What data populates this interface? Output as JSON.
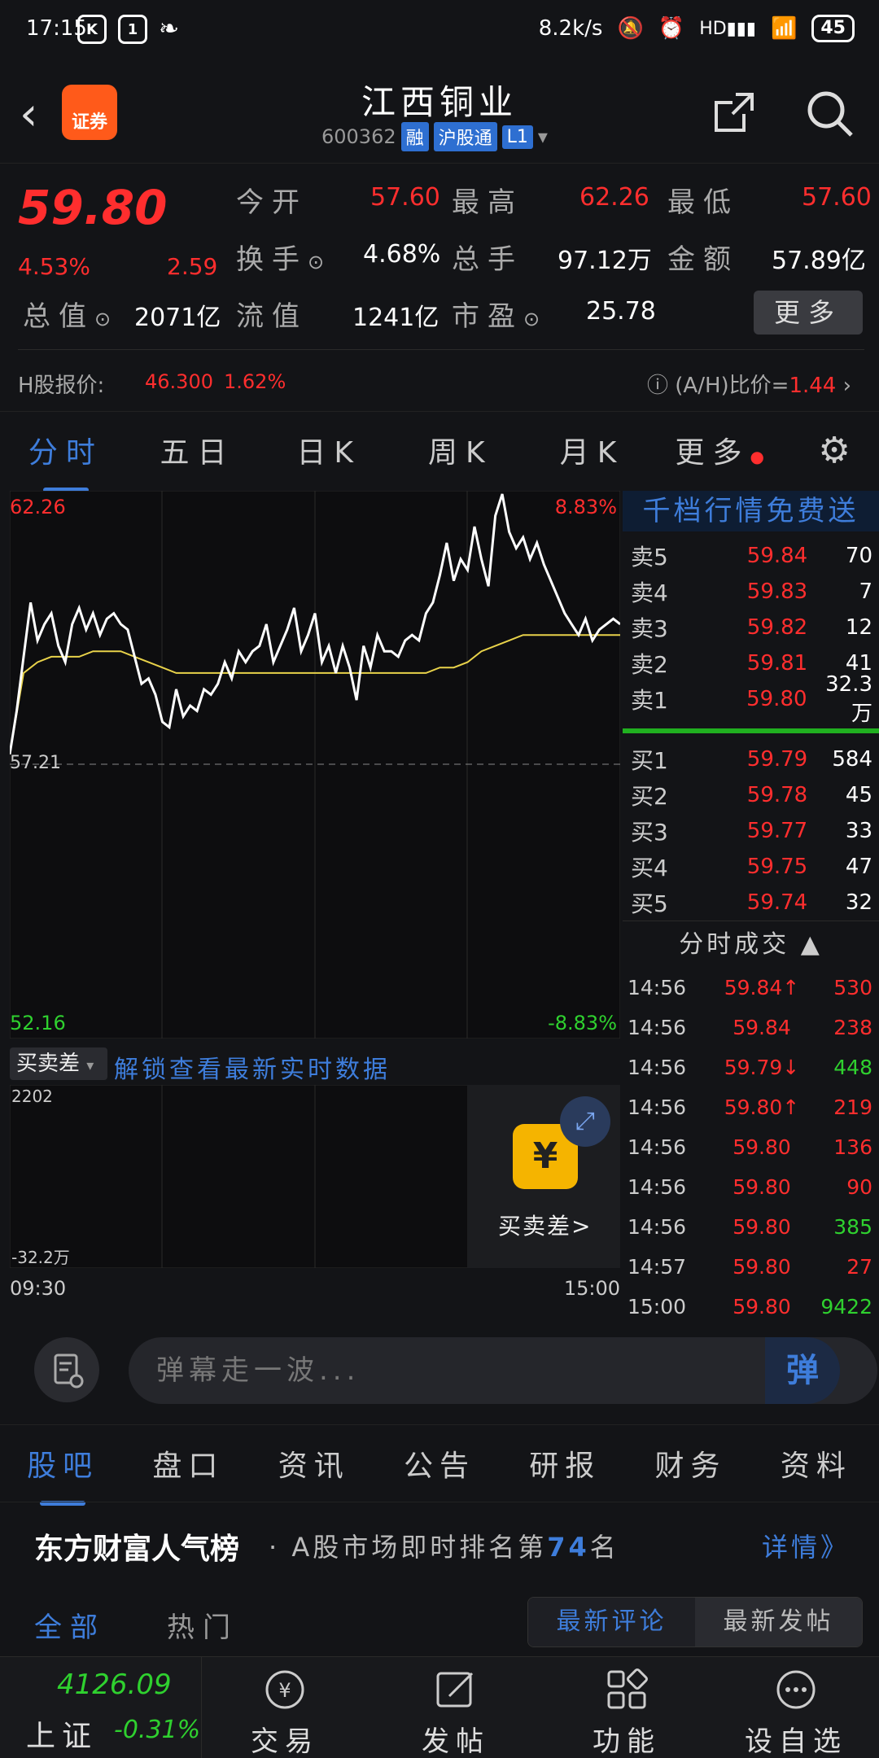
{
  "status_bar": {
    "time": "17:15",
    "speed": "8.2k/s",
    "battery": "45"
  },
  "header": {
    "title": "江西铜业",
    "code": "600362",
    "tags": [
      "融",
      "沪股通",
      "L1"
    ],
    "logo_label": "证券"
  },
  "quote": {
    "price": "59.80",
    "change_pct": "4.53%",
    "change_abs": "2.59",
    "fields": [
      {
        "label": "今开",
        "value": "57.60",
        "color": "red"
      },
      {
        "label": "最高",
        "value": "62.26",
        "color": "red"
      },
      {
        "label": "最低",
        "value": "57.60",
        "color": "red"
      },
      {
        "label": "换手",
        "value": "4.68%",
        "color": "white"
      },
      {
        "label": "总手",
        "value": "97.12万",
        "color": "white"
      },
      {
        "label": "金额",
        "value": "57.89亿",
        "color": "white"
      },
      {
        "label": "总值",
        "value": "2071亿",
        "color": "white"
      },
      {
        "label": "流值",
        "value": "1241亿",
        "color": "white"
      },
      {
        "label": "市盈",
        "value": "25.78",
        "color": "white"
      }
    ],
    "more_label": "更多",
    "h_share_label": "H股报价:",
    "h_share_price": "46.300",
    "h_share_pct": "1.62%",
    "ah_label": "(A/H)比价=",
    "ah_value": "1.44"
  },
  "chart_tabs": [
    "分时",
    "五日",
    "日K",
    "周K",
    "月K",
    "更多"
  ],
  "chart": {
    "y_high": "62.26",
    "y_high_pct": "8.83%",
    "y_mid": "57.21",
    "y_low": "52.16",
    "y_low_pct": "-8.83%",
    "time_start": "09:30",
    "time_end": "15:00",
    "indicator_label": "买卖差",
    "indicator_unlock": "解锁查看最新实时数据",
    "indicator_top": "2202",
    "indicator_bottom": "-32.2万",
    "indicator_promo": "买卖差>"
  },
  "chart_data": {
    "type": "line",
    "title": "",
    "ylim": [
      52.16,
      62.26
    ],
    "series": [
      {
        "values": [
          57.4,
          58.2,
          59.2,
          60.2,
          59.5,
          59.8,
          60.0,
          59.4,
          59.1,
          59.8,
          60.1,
          59.7,
          60.0,
          59.6,
          59.9,
          60.0,
          59.8,
          59.7,
          59.2,
          58.7,
          58.8,
          58.5,
          58.0,
          57.9,
          58.6,
          58.1,
          58.3,
          58.2,
          58.6,
          58.5,
          58.7,
          59.1,
          58.8,
          59.3,
          59.1,
          59.3,
          59.4,
          59.8,
          59.1,
          59.4,
          59.7,
          60.1,
          59.3,
          59.6,
          60.0,
          59.1,
          59.4,
          58.9,
          59.4,
          59.0,
          58.4,
          59.4,
          59.0,
          59.6,
          59.3,
          59.3,
          59.2,
          59.5,
          59.6,
          59.5,
          60.0,
          60.2,
          60.7,
          61.3,
          60.6,
          61.0,
          60.8,
          61.6,
          61.0,
          60.5,
          61.8,
          62.2,
          61.5,
          61.2,
          61.4,
          61.0,
          61.3,
          60.9,
          60.6,
          60.3,
          60.0,
          59.8,
          59.6,
          59.9,
          59.5,
          59.7,
          59.8,
          59.9,
          59.8
        ]
      },
      {
        "values": [
          57.4,
          58.9,
          59.1,
          59.2,
          59.2,
          59.2,
          59.3,
          59.3,
          59.3,
          59.2,
          59.1,
          59.0,
          58.9,
          58.9,
          58.9,
          58.9,
          58.9,
          58.9,
          58.9,
          58.9,
          58.9,
          58.9,
          58.9,
          58.9,
          58.9,
          58.9,
          58.9,
          58.9,
          58.9,
          58.9,
          58.9,
          59.0,
          59.0,
          59.1,
          59.3,
          59.4,
          59.5,
          59.6,
          59.6,
          59.6,
          59.6,
          59.6,
          59.6,
          59.6,
          59.6
        ]
      }
    ]
  },
  "order_book": {
    "header": "千档行情免费送",
    "sells": [
      {
        "name": "卖5",
        "price": "59.84",
        "vol": "70"
      },
      {
        "name": "卖4",
        "price": "59.83",
        "vol": "7"
      },
      {
        "name": "卖3",
        "price": "59.82",
        "vol": "12"
      },
      {
        "name": "卖2",
        "price": "59.81",
        "vol": "41"
      },
      {
        "name": "卖1",
        "price": "59.80",
        "vol": "32.3万"
      }
    ],
    "buys": [
      {
        "name": "买1",
        "price": "59.79",
        "vol": "584"
      },
      {
        "name": "买2",
        "price": "59.78",
        "vol": "45"
      },
      {
        "name": "买3",
        "price": "59.77",
        "vol": "33"
      },
      {
        "name": "买4",
        "price": "59.75",
        "vol": "47"
      },
      {
        "name": "买5",
        "price": "59.74",
        "vol": "32"
      }
    ],
    "trades_header": "分时成交",
    "trades": [
      {
        "time": "14:56",
        "price": "59.84↑",
        "vol": "530",
        "color": "red"
      },
      {
        "time": "14:56",
        "price": "59.84",
        "vol": "238",
        "color": "red"
      },
      {
        "time": "14:56",
        "price": "59.79↓",
        "vol": "448",
        "color": "green"
      },
      {
        "time": "14:56",
        "price": "59.80↑",
        "vol": "219",
        "color": "red"
      },
      {
        "time": "14:56",
        "price": "59.80",
        "vol": "136",
        "color": "red"
      },
      {
        "time": "14:56",
        "price": "59.80",
        "vol": "90",
        "color": "red"
      },
      {
        "time": "14:56",
        "price": "59.80",
        "vol": "385",
        "color": "green"
      },
      {
        "time": "14:57",
        "price": "59.80",
        "vol": "27",
        "color": "red"
      },
      {
        "time": "15:00",
        "price": "59.80",
        "vol": "9422",
        "color": "green"
      }
    ]
  },
  "comment": {
    "placeholder": "弹幕走一波...",
    "button": "弹"
  },
  "info_tabs": [
    "股吧",
    "盘口",
    "资讯",
    "公告",
    "研报",
    "财务",
    "资料"
  ],
  "popularity": {
    "brand": "东方财富人气榜",
    "text_before": "· A股市场即时排名第",
    "rank": "74",
    "text_after": "名",
    "more": "详情》"
  },
  "filter": {
    "all": "全部",
    "hot": "热门",
    "latest_comment": "最新评论",
    "latest_post": "最新发帖"
  },
  "bottom_nav": {
    "index_value": "4126.09",
    "index_name": "上证",
    "index_change": "-0.31%",
    "items": [
      "交易",
      "发帖",
      "功能",
      "设自选"
    ]
  }
}
